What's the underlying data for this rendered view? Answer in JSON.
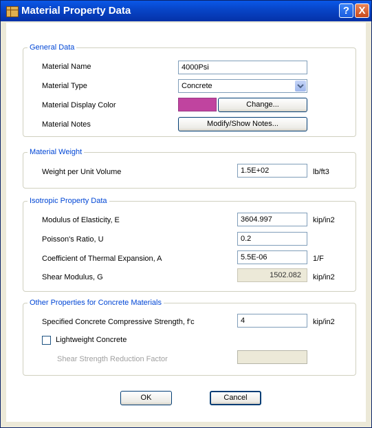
{
  "window": {
    "title": "Material Property Data",
    "help_label": "?",
    "close_label": "X"
  },
  "general": {
    "legend": "General Data",
    "material_name_label": "Material Name",
    "material_name_value": "4000Psi",
    "material_type_label": "Material Type",
    "material_type_value": "Concrete",
    "display_color_label": "Material Display Color",
    "display_color": "#c0449f",
    "change_button": "Change...",
    "notes_label": "Material Notes",
    "notes_button": "Modify/Show Notes..."
  },
  "weight": {
    "legend": "Material Weight",
    "label": "Weight per Unit Volume",
    "value": "1.5E+02",
    "unit": "lb/ft3"
  },
  "isotropic": {
    "legend": "Isotropic Property Data",
    "modulus_label": "Modulus of Elasticity,  E",
    "modulus_value": "3604.997",
    "modulus_unit": "kip/in2",
    "poisson_label": "Poisson's Ratio,  U",
    "poisson_value": "0.2",
    "thermal_label": "Coefficient of Thermal Expansion,  A",
    "thermal_value": "5.5E-06",
    "thermal_unit": "1/F",
    "shear_label": "Shear Modulus,  G",
    "shear_value": "1502.082",
    "shear_unit": "kip/in2"
  },
  "concrete": {
    "legend": "Other Properties for Concrete Materials",
    "fc_label": "Specified Concrete Compressive Strength, f'c",
    "fc_value": "4",
    "fc_unit": "kip/in2",
    "lightweight_label": "Lightweight Concrete",
    "lightweight_checked": false,
    "shear_reduction_label": "Shear Strength Reduction Factor",
    "shear_reduction_value": ""
  },
  "footer": {
    "ok": "OK",
    "cancel": "Cancel"
  },
  "colors": {
    "title_bar": "#0846c9",
    "legend_text": "#0046d5",
    "dialog_bg": "#ece9d8"
  }
}
